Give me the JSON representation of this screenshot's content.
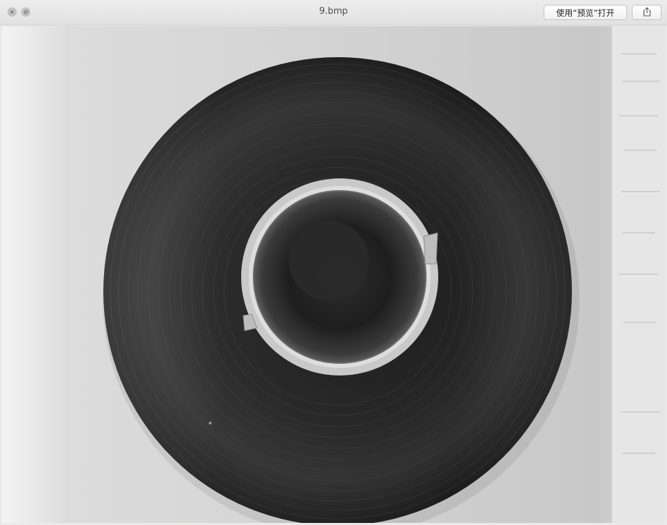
{
  "window": {
    "title": "9.bmp",
    "open_with_button": "使用“预览”打开",
    "close_icon": "close-icon",
    "minimize_icon": "minimize-disabled-icon",
    "share_icon": "share-icon"
  },
  "image": {
    "subject": "spool-of-dark-film"
  }
}
